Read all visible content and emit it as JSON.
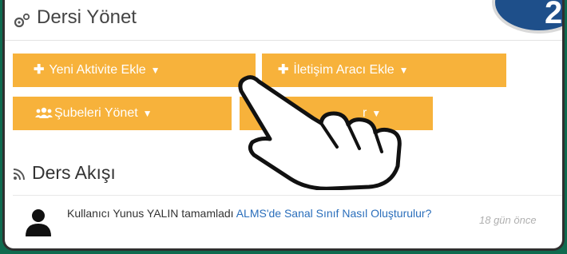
{
  "header": {
    "title": "Dersi Yönet",
    "step_badge": "2"
  },
  "buttons": {
    "new_activity": "Yeni Aktivite Ekle",
    "new_communication": "İletişim Aracı Ekle",
    "manage_sections": "Şubeleri Yönet",
    "hidden_button_fragment": "r"
  },
  "feed": {
    "title": "Ders Akışı",
    "items": [
      {
        "user_text": "Kullanıcı Yunus YALIN tamamladı",
        "link_text": "ALMS'de Sanal Sınıf Nasıl Oluşturulur?",
        "time": "18 gün önce"
      }
    ]
  },
  "colors": {
    "accent": "#f7b23b",
    "frame": "#0f6b4f",
    "link": "#2a6ebb"
  },
  "icons": [
    "gear-icon",
    "plus-icon",
    "chevron-down-icon",
    "users-icon",
    "rss-icon",
    "user-avatar-icon",
    "pointing-hand-icon"
  ]
}
